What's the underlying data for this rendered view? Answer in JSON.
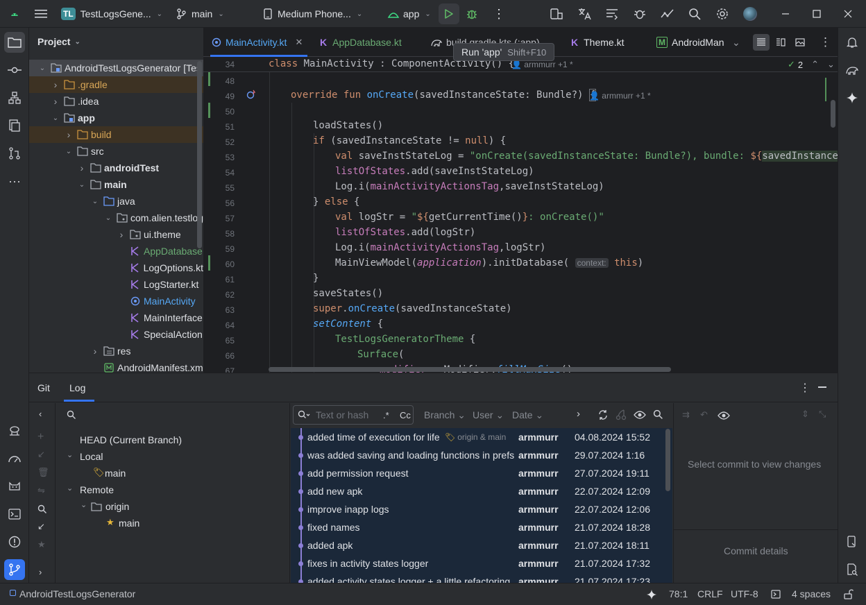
{
  "titlebar": {
    "project_badge": "TL",
    "project_name": "TestLogsGene...",
    "branch": "main",
    "device": "Medium Phone...",
    "run_config": "app"
  },
  "tooltip": {
    "text": "Run 'app'",
    "shortcut": "Shift+F10"
  },
  "project_panel": {
    "title": "Project",
    "tree": [
      {
        "label": "AndroidTestLogsGenerator [Tes",
        "indent": 0,
        "expanded": true,
        "icon": "module-icon",
        "selected": true
      },
      {
        "label": ".gradle",
        "indent": 1,
        "expanded": false,
        "icon": "folder-orange-icon",
        "excluded": true
      },
      {
        "label": ".idea",
        "indent": 1,
        "expanded": false,
        "icon": "folder-icon"
      },
      {
        "label": "app",
        "indent": 1,
        "expanded": true,
        "icon": "module-icon",
        "bold": true
      },
      {
        "label": "build",
        "indent": 2,
        "expanded": false,
        "icon": "folder-orange-icon",
        "excluded": true
      },
      {
        "label": "src",
        "indent": 2,
        "expanded": true,
        "icon": "folder-icon"
      },
      {
        "label": "androidTest",
        "indent": 3,
        "expanded": false,
        "icon": "folder-icon",
        "bold": true
      },
      {
        "label": "main",
        "indent": 3,
        "expanded": true,
        "icon": "folder-icon",
        "bold": true
      },
      {
        "label": "java",
        "indent": 4,
        "expanded": true,
        "icon": "folder-blue-icon"
      },
      {
        "label": "com.alien.testlog",
        "indent": 5,
        "expanded": true,
        "icon": "package-icon"
      },
      {
        "label": "ui.theme",
        "indent": 6,
        "expanded": false,
        "icon": "package-icon"
      },
      {
        "label": "AppDatabase",
        "indent": 6,
        "icon": "kotlin-file-icon",
        "color": "#6aab73"
      },
      {
        "label": "LogOptions.kt",
        "indent": 6,
        "icon": "kotlin-file-icon"
      },
      {
        "label": "LogStarter.kt",
        "indent": 6,
        "icon": "kotlin-file-icon"
      },
      {
        "label": "MainActivity",
        "indent": 6,
        "icon": "activity-icon",
        "color": "#56a8f5"
      },
      {
        "label": "MainInterface",
        "indent": 6,
        "icon": "kotlin-file-icon"
      },
      {
        "label": "SpecialAction",
        "indent": 6,
        "icon": "kotlin-file-icon"
      },
      {
        "label": "res",
        "indent": 4,
        "expanded": false,
        "icon": "res-folder-icon"
      },
      {
        "label": "AndroidManifest.xm",
        "indent": 4,
        "icon": "manifest-icon"
      }
    ]
  },
  "editor": {
    "tabs": [
      {
        "label": "MainActivity.kt",
        "active": true
      },
      {
        "label": "AppDatabase.kt"
      },
      {
        "label": "build.gradle.kts (:app)"
      },
      {
        "label": "Theme.kt"
      },
      {
        "label": "AndroidMan"
      }
    ],
    "sticky_line": {
      "num": "34",
      "code": "class MainActivity : ComponentActivity() {",
      "author": "armmurr +1 *"
    },
    "problems_count": "2",
    "lines": [
      {
        "num": "48",
        "code": ""
      },
      {
        "num": "49",
        "code": "override fun onCreate(savedInstanceState: Bundle?) {",
        "author": "armmurr +1 *"
      },
      {
        "num": "50",
        "code": ""
      },
      {
        "num": "51",
        "code": "loadStates()"
      },
      {
        "num": "52",
        "code": "if (savedInstanceState != null) {"
      },
      {
        "num": "53",
        "code": "val saveInstStateLog = \"onCreate(savedInstanceState: Bundle?), bundle: ${savedInstanceState"
      },
      {
        "num": "54",
        "code": "listOfStates.add(saveInstStateLog)"
      },
      {
        "num": "55",
        "code": "Log.i(mainActivityActionsTag,saveInstStateLog)"
      },
      {
        "num": "56",
        "code": "} else {"
      },
      {
        "num": "57",
        "code": "val logStr = \"${getCurrentTime()}: onCreate()\""
      },
      {
        "num": "58",
        "code": "listOfStates.add(logStr)"
      },
      {
        "num": "59",
        "code": "Log.i(mainActivityActionsTag,logStr)"
      },
      {
        "num": "60",
        "code": "MainViewModel(application).initDatabase( context: this)"
      },
      {
        "num": "61",
        "code": "}"
      },
      {
        "num": "62",
        "code": "saveStates()"
      },
      {
        "num": "63",
        "code": "super.onCreate(savedInstanceState)"
      },
      {
        "num": "64",
        "code": "setContent {"
      },
      {
        "num": "65",
        "code": "TestLogsGeneratorTheme {"
      },
      {
        "num": "66",
        "code": "Surface("
      },
      {
        "num": "67",
        "code": "modifier = Modifier.fillMaxSize()"
      }
    ],
    "inlay_context": "context:"
  },
  "bottom_panel": {
    "tabs": [
      "Git",
      "Log"
    ],
    "branches": {
      "head": "HEAD (Current Branch)",
      "local": "Local",
      "local_main": "main",
      "remote": "Remote",
      "origin": "origin",
      "origin_main": "main"
    },
    "filter": {
      "placeholder": "Text or hash",
      "regex": ".*",
      "case": "Cc",
      "branch": "Branch",
      "user": "User",
      "date": "Date"
    },
    "commits": [
      {
        "msg": "added time of execution for life",
        "refs": "origin & main",
        "user": "armmurr",
        "date": "04.08.2024 15:52"
      },
      {
        "msg": "was added saving and loading functions in prefs",
        "user": "armmurr",
        "date": "29.07.2024 1:16"
      },
      {
        "msg": "add permission request",
        "user": "armmurr",
        "date": "27.07.2024 19:11"
      },
      {
        "msg": "add new apk",
        "user": "armmurr",
        "date": "22.07.2024 12:09"
      },
      {
        "msg": "improve inapp logs",
        "user": "armmurr",
        "date": "22.07.2024 12:06"
      },
      {
        "msg": "fixed names",
        "user": "armmurr",
        "date": "21.07.2024 18:28"
      },
      {
        "msg": "added apk",
        "user": "armmurr",
        "date": "21.07.2024 18:11"
      },
      {
        "msg": "fixes in activity states logger",
        "user": "armmurr",
        "date": "21.07.2024 17:32"
      },
      {
        "msg": "added activity states logger + a little refactoring",
        "user": "armmurr",
        "date": "21.07.2024 17:23"
      }
    ],
    "changes_placeholder": "Select commit to view changes",
    "details_placeholder": "Commit details"
  },
  "statusbar": {
    "project": "AndroidTestLogsGenerator",
    "position": "78:1",
    "line_sep": "CRLF",
    "encoding": "UTF-8",
    "indent": "4 spaces"
  },
  "colors": {
    "accent": "#3574f0",
    "selection": "#2e436e",
    "kotlin": "#a57be8"
  }
}
